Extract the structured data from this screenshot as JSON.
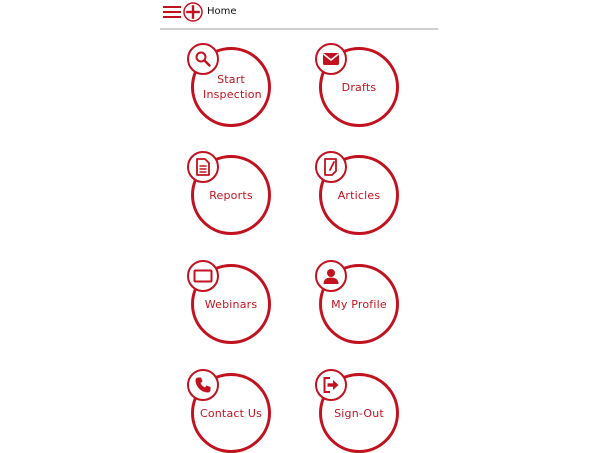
{
  "header": {
    "title": "Home",
    "menu_icon": "hamburger-menu-icon",
    "logo_icon": "red-cross-logo-icon"
  },
  "colors": {
    "accent": "#c1121f",
    "divider": "#cfcfcf",
    "title_text": "#111111",
    "background": "#ffffff"
  },
  "tiles": [
    {
      "label": "Start Inspection",
      "icon": "magnifier-icon"
    },
    {
      "label": "Drafts",
      "icon": "envelope-icon"
    },
    {
      "label": "Reports",
      "icon": "document-icon"
    },
    {
      "label": "Articles",
      "icon": "article-icon"
    },
    {
      "label": "Webinars",
      "icon": "monitor-icon"
    },
    {
      "label": "My Profile",
      "icon": "user-icon"
    },
    {
      "label": "Contact Us",
      "icon": "phone-icon"
    },
    {
      "label": "Sign-Out",
      "icon": "sign-out-icon"
    }
  ]
}
